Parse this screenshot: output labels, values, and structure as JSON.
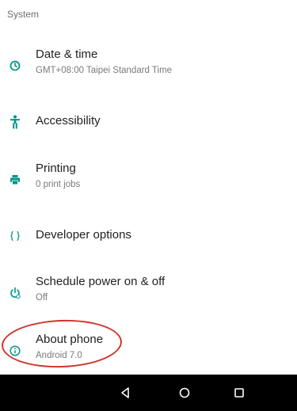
{
  "section": {
    "title": "System"
  },
  "items": [
    {
      "title": "Date & time",
      "summary": "GMT+08:00 Taipei Standard Time",
      "icon": "clock-icon"
    },
    {
      "title": "Accessibility",
      "summary": "",
      "icon": "accessibility-icon"
    },
    {
      "title": "Printing",
      "summary": "0 print jobs",
      "icon": "printer-icon"
    },
    {
      "title": "Developer options",
      "summary": "",
      "icon": "braces-icon"
    },
    {
      "title": "Schedule power on & off",
      "summary": "Off",
      "icon": "power-clock-icon"
    },
    {
      "title": "About phone",
      "summary": "Android 7.0",
      "icon": "info-icon"
    }
  ],
  "colors": {
    "accent": "#009688",
    "highlight": "#d0332b",
    "navbar": "#000000"
  },
  "navbar": {
    "buttons": [
      "back-icon",
      "home-icon",
      "recents-icon"
    ]
  }
}
